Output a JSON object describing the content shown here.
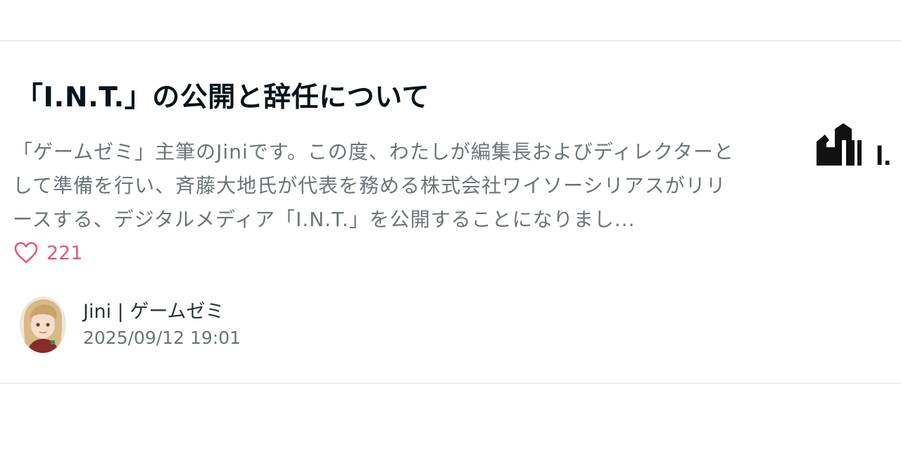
{
  "article": {
    "title": "「I.N.T.」の公開と辞任について",
    "excerpt": "「ゲームゼミ」主筆のJiniです。この度、わたしが編集長およびディレクターとして準備を行い、斉藤大地氏が代表を務める株式会社ワイソーシリアスがリリースする、デジタルメディア「I.N.T.」を公開することになりまし...",
    "like_count": "221",
    "author_name": "Jini | ゲームゼミ",
    "date": "2025/09/12 19:01",
    "thumbnail_text": "I.",
    "like_icon": "heart-outline-icon",
    "accent_color": "#e05a7a"
  }
}
